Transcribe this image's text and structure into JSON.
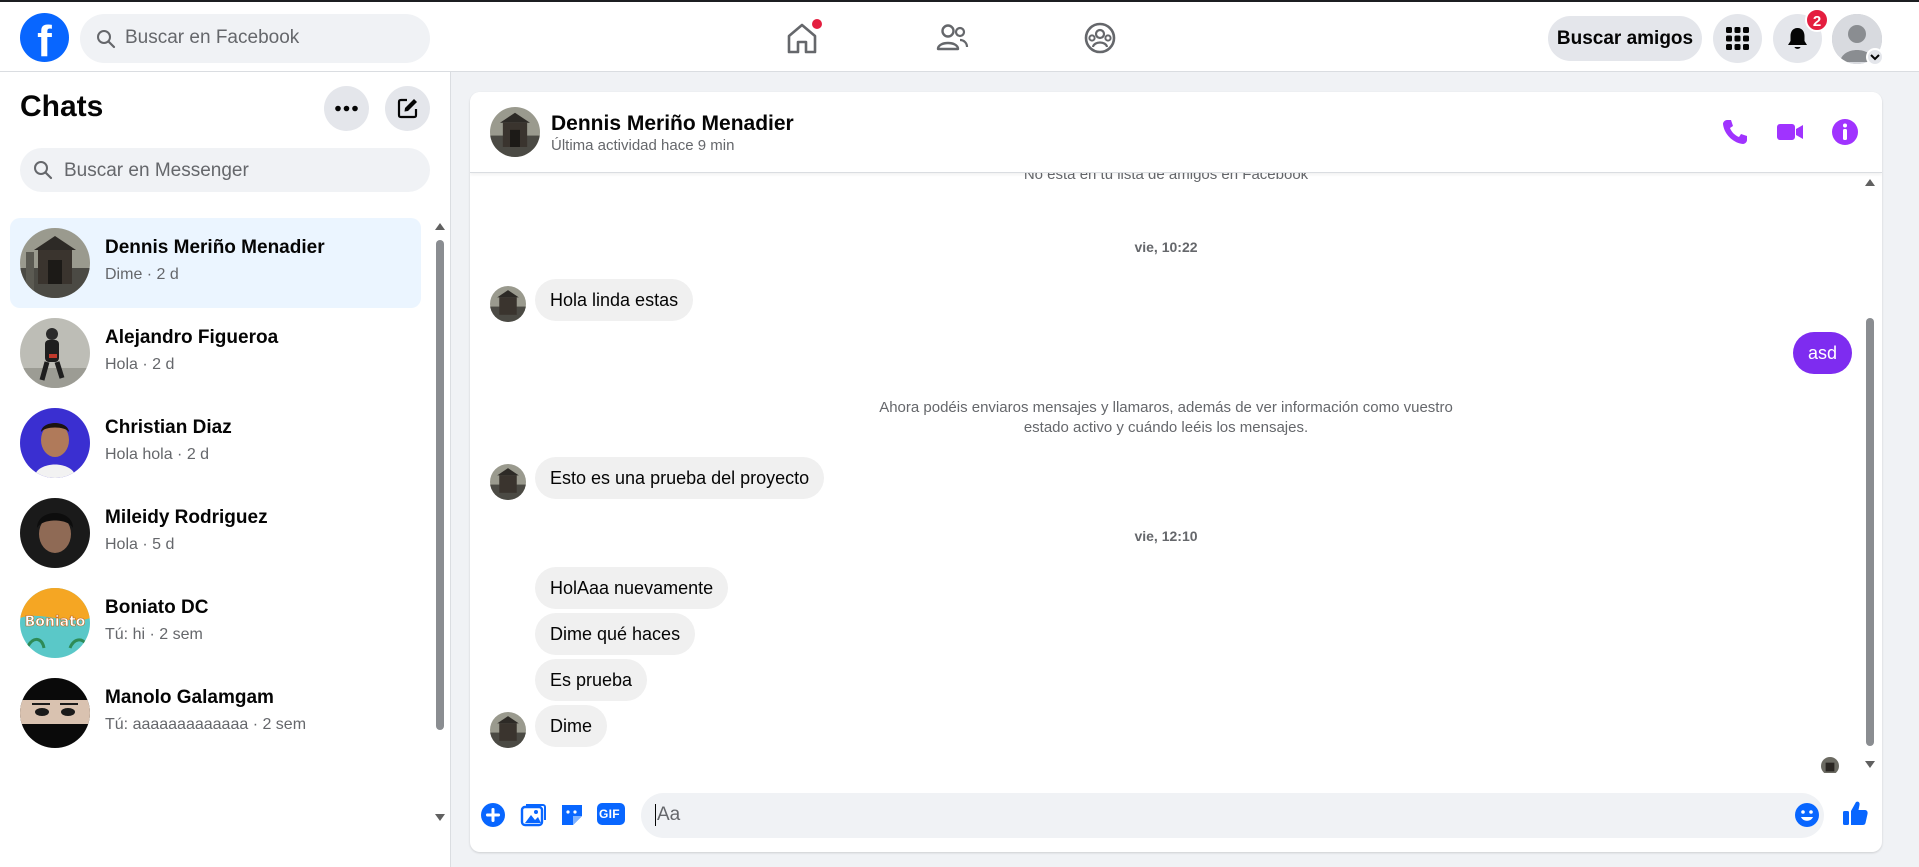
{
  "topbar": {
    "logo_letter": "f",
    "search_placeholder": "Buscar en Facebook",
    "find_friends_label": "Buscar amigos",
    "notifications_count": "2",
    "brand_color": "#0866ff"
  },
  "sidebar": {
    "title": "Chats",
    "search_placeholder": "Buscar en Messenger",
    "chats": [
      {
        "name": "Dennis Meriño Menadier",
        "preview": "Dime · 2 d"
      },
      {
        "name": "Alejandro Figueroa",
        "preview": "Hola · 2 d"
      },
      {
        "name": "Christian Diaz",
        "preview": "Hola hola · 2 d"
      },
      {
        "name": "Mileidy Rodriguez",
        "preview": "Hola · 5 d"
      },
      {
        "name": "Boniato DC",
        "preview": "Tú: hi · 2 sem"
      },
      {
        "name": "Manolo Galamgam",
        "preview": "Tú: aaaaaaaaaaaaa · 2 sem"
      }
    ],
    "boniato_logo_text": "Boniato"
  },
  "conversation": {
    "name": "Dennis Meriño Menadier",
    "status": "Última actividad hace 9 min",
    "accent_color": "#a033ff",
    "cut_notice": "No está en tu lista de amigos en Facebook",
    "time_1": "vie, 10:22",
    "msg_1": "Hola linda estas",
    "msg_me": "asd",
    "system_notice": "Ahora podéis enviaros mensajes y llamaros, además de ver información como vuestro estado activo y cuándo leéis los mensajes.",
    "msg_2": "Esto es una prueba del proyecto",
    "time_2": "vie, 12:10",
    "msg_3": "HolAaa nuevamente",
    "msg_4": "Dime qué haces",
    "msg_5": "Es prueba",
    "msg_6": "Dime",
    "composer_placeholder": "Aa",
    "gif_label": "GIF"
  },
  "icons": [
    "search-icon",
    "home-icon",
    "friends-icon",
    "groups-icon",
    "menu-grid-icon",
    "bell-icon",
    "more-icon",
    "compose-icon",
    "phone-icon",
    "video-icon",
    "info-icon",
    "plus-icon",
    "image-icon",
    "sticker-icon",
    "gif-icon",
    "emoji-icon",
    "like-icon"
  ]
}
